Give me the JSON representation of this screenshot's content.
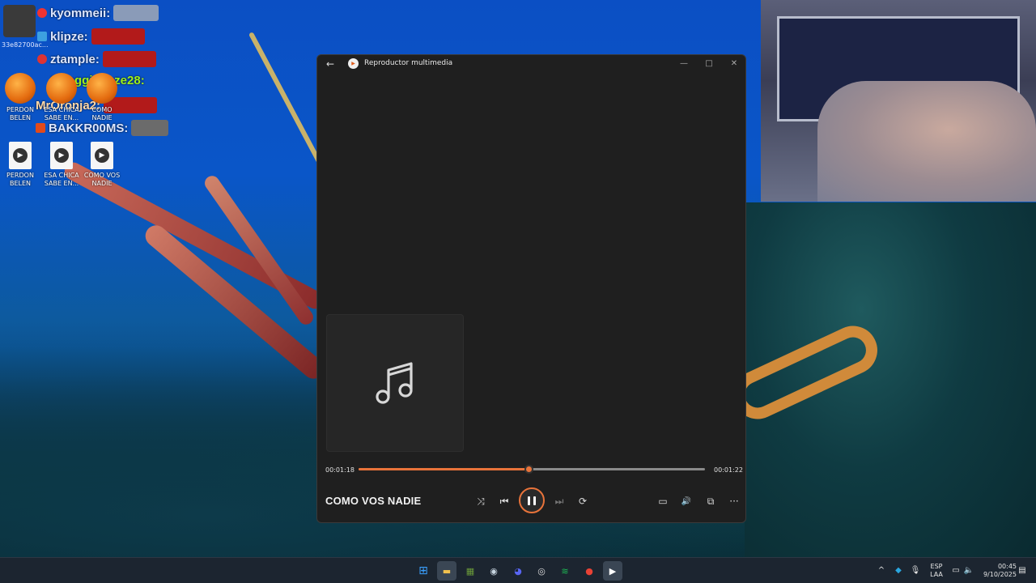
{
  "chat": {
    "hash": "33e82700ac...",
    "messages": [
      {
        "user": "kyommeii:"
      },
      {
        "user": "klipze:"
      },
      {
        "user": "ztample:"
      },
      {
        "user": "Swagginhaze28:"
      },
      {
        "user": "MrOronja2:"
      },
      {
        "user": "BAKKR00MS:"
      }
    ]
  },
  "desktop_icons": {
    "top_row": [
      {
        "label_line1": "PERDON",
        "label_line2": "BELEN"
      },
      {
        "label_line1": "ESA CHICA",
        "label_line2": "SABE EN..."
      },
      {
        "label_line1": "COMO",
        "label_line2": "NADIE"
      }
    ],
    "bottom_row": [
      {
        "label_line1": "PERDON",
        "label_line2": "BELEN",
        "icon": "media-file-icon"
      },
      {
        "label_line1": "ESA CHICA",
        "label_line2": "SABE EN...",
        "icon": "media-file-icon"
      },
      {
        "label_line1": "COMO VOS",
        "label_line2": "NADIE",
        "icon": "media-file-icon"
      }
    ]
  },
  "player": {
    "app_title": "Reproductor multimedia",
    "song_title": "COMO VOS NADIE",
    "elapsed": "00:01:18",
    "remaining": "00:01:22",
    "progress_fraction": 0.49,
    "accent_color": "#e8733a",
    "controls": {
      "shuffle": "⤨",
      "previous": "⏮",
      "next": "⏭",
      "repeat": "⟳",
      "miniplayer": "▭",
      "volume": "🔊",
      "cast": "⧉",
      "more": "···",
      "back": "←",
      "minimize": "—",
      "maximize": "□",
      "close": "✕"
    }
  },
  "taskbar": {
    "apps": [
      {
        "name": "start",
        "glyph": "⊞",
        "color": "#3aa0ff"
      },
      {
        "name": "file-explorer",
        "glyph": "▬",
        "color": "#f2c14e"
      },
      {
        "name": "minecraft",
        "glyph": "▦",
        "color": "#6a9a3a"
      },
      {
        "name": "steam",
        "glyph": "◉",
        "color": "#c7d5e0"
      },
      {
        "name": "discord",
        "glyph": "◕",
        "color": "#5865f2"
      },
      {
        "name": "obs",
        "glyph": "◎",
        "color": "#dddddd"
      },
      {
        "name": "spotify",
        "glyph": "≋",
        "color": "#1db954"
      },
      {
        "name": "chrome",
        "glyph": "●",
        "color": "#e94235"
      },
      {
        "name": "media-player",
        "glyph": "▶",
        "color": "#ffffff"
      }
    ],
    "tray": {
      "chevron": "^",
      "lang_top": "ESP",
      "lang_bottom": "LAA",
      "time": "00:45",
      "date": "9/10/2025"
    }
  }
}
